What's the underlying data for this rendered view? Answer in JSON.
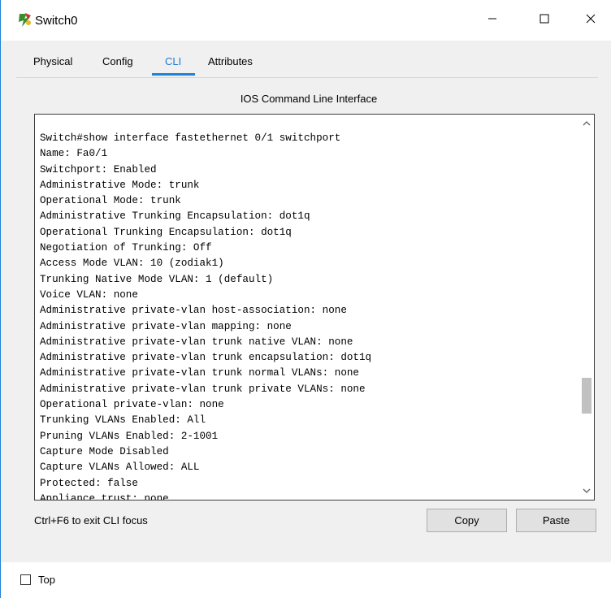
{
  "window": {
    "title": "Switch0",
    "icon": "switch-device-icon",
    "controls": {
      "minimize": "minimize-icon",
      "maximize": "maximize-icon",
      "close": "close-icon"
    }
  },
  "tabs": [
    {
      "label": "Physical",
      "active": false
    },
    {
      "label": "Config",
      "active": false
    },
    {
      "label": "CLI",
      "active": true
    },
    {
      "label": "Attributes",
      "active": false
    }
  ],
  "panel": {
    "title": "IOS Command Line Interface"
  },
  "cli": {
    "lines": [
      "Switch#show interface fastethernet 0/1 switchport",
      "Name: Fa0/1",
      "Switchport: Enabled",
      "Administrative Mode: trunk",
      "Operational Mode: trunk",
      "Administrative Trunking Encapsulation: dot1q",
      "Operational Trunking Encapsulation: dot1q",
      "Negotiation of Trunking: Off",
      "Access Mode VLAN: 10 (zodiak1)",
      "Trunking Native Mode VLAN: 1 (default)",
      "Voice VLAN: none",
      "Administrative private-vlan host-association: none",
      "Administrative private-vlan mapping: none",
      "Administrative private-vlan trunk native VLAN: none",
      "Administrative private-vlan trunk encapsulation: dot1q",
      "Administrative private-vlan trunk normal VLANs: none",
      "Administrative private-vlan trunk private VLANs: none",
      "Operational private-vlan: none",
      "Trunking VLANs Enabled: All",
      "Pruning VLANs Enabled: 2-1001",
      "Capture Mode Disabled",
      "Capture VLANs Allowed: ALL",
      "Protected: false",
      "Appliance trust: none"
    ],
    "scroll_position": 0.78
  },
  "footer": {
    "hint": "Ctrl+F6 to exit CLI focus",
    "copy_label": "Copy",
    "paste_label": "Paste"
  },
  "options": {
    "top_label": "Top",
    "top_checked": false
  },
  "colors": {
    "accent": "#1e82d6",
    "active_tab_text": "#1e7ad6",
    "dialog_bg": "#f0f0f0",
    "button_bg": "#e1e1e1"
  }
}
